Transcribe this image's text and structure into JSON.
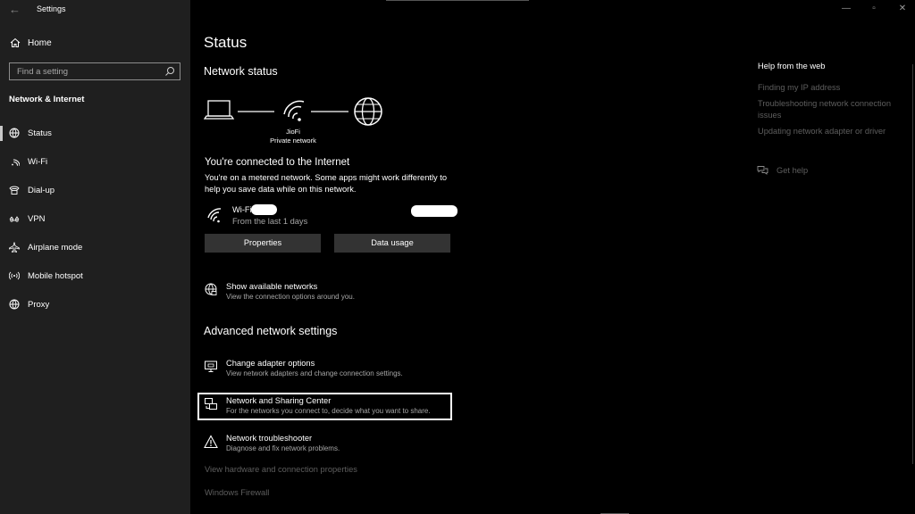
{
  "window": {
    "title": "Settings",
    "controls": {
      "minimize": "—",
      "maximize": "▫",
      "close": "✕"
    }
  },
  "sidebar": {
    "home_label": "Home",
    "search_placeholder": "Find a setting",
    "section_title": "Network & Internet",
    "items": [
      {
        "label": "Status",
        "icon": "globe-icon",
        "active": true
      },
      {
        "label": "Wi-Fi",
        "icon": "wifi-icon"
      },
      {
        "label": "Dial-up",
        "icon": "dialup-icon"
      },
      {
        "label": "VPN",
        "icon": "vpn-icon"
      },
      {
        "label": "Airplane mode",
        "icon": "airplane-icon"
      },
      {
        "label": "Mobile hotspot",
        "icon": "hotspot-icon"
      },
      {
        "label": "Proxy",
        "icon": "globe-icon"
      }
    ]
  },
  "main": {
    "page_title": "Status",
    "network_status_heading": "Network status",
    "network_name": "JioFi",
    "network_type": "Private network",
    "connected_title": "You're connected to the Internet",
    "connected_desc": "You're on a metered network. Some apps might work differently to help you save data while on this network.",
    "wifi_label": "Wi-Fi",
    "wifi_sub": "From the last 1 days",
    "properties_button": "Properties",
    "data_usage_button": "Data usage",
    "show_networks": {
      "title": "Show available networks",
      "sub": "View the connection options around you."
    },
    "advanced_heading": "Advanced network settings",
    "advanced_items": [
      {
        "title": "Change adapter options",
        "sub": "View network adapters and change connection settings.",
        "icon": "adapter-icon"
      },
      {
        "title": "Network and Sharing Center",
        "sub": "For the networks you connect to, decide what you want to share.",
        "icon": "sharing-icon"
      },
      {
        "title": "Network troubleshooter",
        "sub": "Diagnose and fix network problems.",
        "icon": "warning-icon"
      }
    ],
    "hardware_link": "View hardware and connection properties",
    "firewall_link": "Windows Firewall"
  },
  "help": {
    "title": "Help from the web",
    "links": [
      "Finding my IP address",
      "Troubleshooting network connection issues",
      "Updating network adapter or driver"
    ],
    "get_help": "Get help"
  },
  "colors": {
    "sidebar_bg": "#1f1f1f",
    "main_bg": "#000000",
    "button_bg": "#333333",
    "muted_text": "#a6a6a6",
    "disabled_link": "#5e5e5e"
  }
}
